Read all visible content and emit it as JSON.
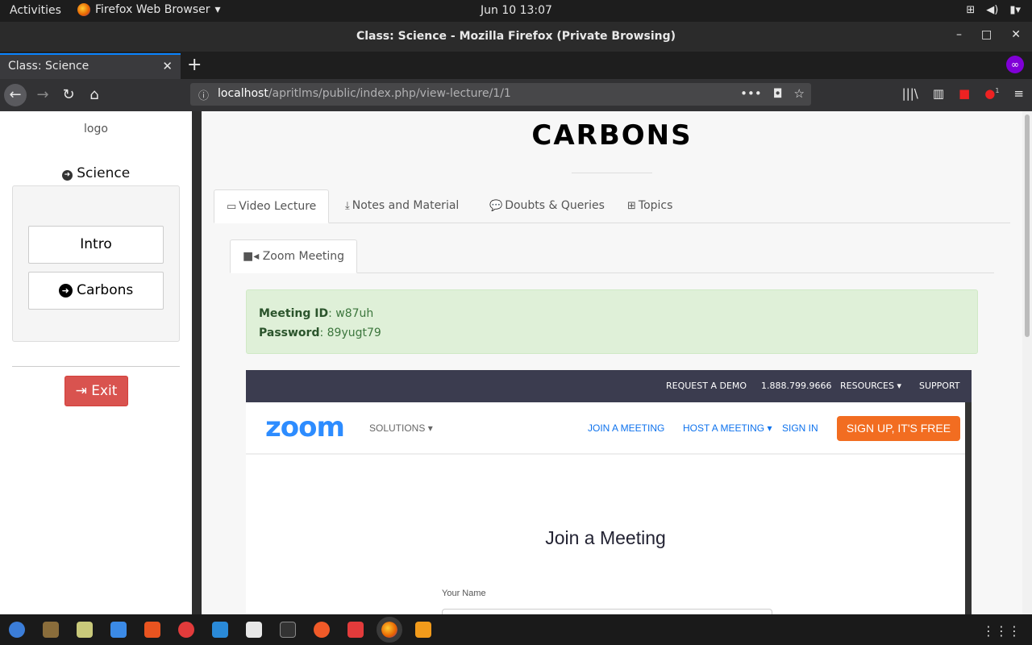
{
  "topbar": {
    "activities": "Activities",
    "app_menu": "Firefox Web Browser",
    "clock": "Jun 10  13:07"
  },
  "window": {
    "title": "Class: Science - Mozilla Firefox (Private Browsing)"
  },
  "browser": {
    "tab_title": "Class: Science",
    "url_host": "localhost",
    "url_path": "/apritlms/public/index.php/view-lecture/1/1",
    "notification_count": "1"
  },
  "sidebar": {
    "logo": "logo",
    "course": "Science",
    "lessons": [
      {
        "label": "Intro"
      },
      {
        "label": "Carbons"
      }
    ],
    "exit_label": "Exit"
  },
  "lecture": {
    "title": "CARBONS",
    "tabs": [
      {
        "label": "Video Lecture",
        "icon": "monitor-icon"
      },
      {
        "label": "Notes and Material",
        "icon": "download-icon"
      },
      {
        "label": "Doubts & Queries",
        "icon": "comments-icon"
      },
      {
        "label": "Topics",
        "icon": "table-icon"
      }
    ],
    "subtab": "Zoom Meeting",
    "meeting": {
      "id_label": "Meeting ID",
      "id_value": ": w87uh",
      "password_label": "Password",
      "password_value": ": 89yugt79"
    }
  },
  "zoom": {
    "top_links": [
      "REQUEST A DEMO",
      "1.888.799.9666",
      "RESOURCES",
      "SUPPORT"
    ],
    "logo": "zoom",
    "solutions": "SOLUTIONS",
    "join_meeting": "JOIN A MEETING",
    "host_meeting": "HOST A MEETING",
    "sign_in": "SIGN IN",
    "signup": "SIGN UP, IT'S FREE",
    "heading": "Join a Meeting",
    "name_label": "Your Name"
  },
  "colors": {
    "exit_button": "#d9534f",
    "alert_bg": "#dff0d8",
    "zoom_blue": "#2d8cff",
    "zoom_orange": "#f26d21",
    "private_purple": "#8000d7"
  }
}
